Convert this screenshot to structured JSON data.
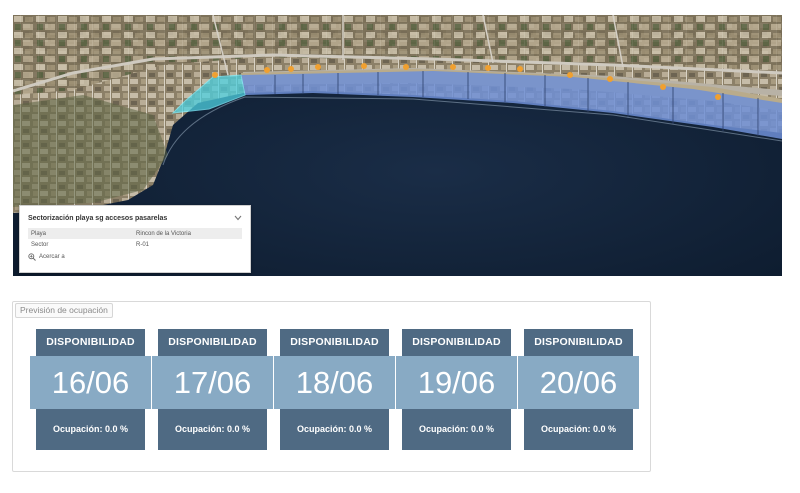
{
  "map": {
    "popup": {
      "title": "Sectorización playa sg accesos pasarelas",
      "collapse_icon": "chevron-down-icon",
      "rows": [
        {
          "key": "Playa",
          "value": "Rincon de la Victoria"
        },
        {
          "key": "Sector",
          "value": "R-01"
        }
      ],
      "zoom_label": "Acercar a",
      "zoom_icon": "zoom-in-icon"
    },
    "colors": {
      "sector_fill": "#6f8fd6",
      "selected_sector": "#4dd0e1",
      "marker": "#f0a030"
    }
  },
  "panel": {
    "title": "Previsión de ocupación",
    "cards": [
      {
        "header": "DISPONIBILIDAD",
        "date": "16/06",
        "occupancy": "Ocupación: 0.0 %"
      },
      {
        "header": "DISPONIBILIDAD",
        "date": "17/06",
        "occupancy": "Ocupación: 0.0 %"
      },
      {
        "header": "DISPONIBILIDAD",
        "date": "18/06",
        "occupancy": "Ocupación: 0.0 %"
      },
      {
        "header": "DISPONIBILIDAD",
        "date": "19/06",
        "occupancy": "Ocupación: 0.0 %"
      },
      {
        "header": "DISPONIBILIDAD",
        "date": "20/06",
        "occupancy": "Ocupación: 0.0 %"
      }
    ],
    "colors": {
      "card_dark": "#4f6a83",
      "card_light": "#88aac4"
    }
  }
}
